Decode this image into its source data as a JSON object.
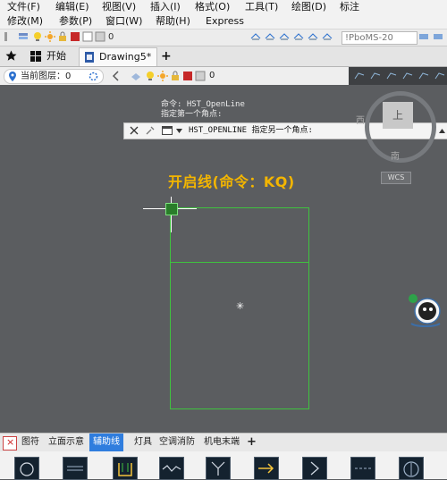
{
  "menu": {
    "row1": [
      "文件(F)",
      "编辑(E)",
      "视图(V)",
      "插入(I)",
      "格式(O)",
      "工具(T)",
      "绘图(D)",
      "标注"
    ],
    "row2": [
      "修改(M)",
      "参数(P)",
      "窗口(W)",
      "帮助(H)",
      "Express"
    ]
  },
  "toolbar": {
    "layer_value": "0",
    "right_field": "!PboMS-20"
  },
  "tabs": {
    "start_label": "开始",
    "drawing_label": "Drawing5*",
    "add_label": "+"
  },
  "layerbar": {
    "current_layer_label": "当前图层：0",
    "layer_value": "0"
  },
  "command": {
    "line1": "命令: HST_OpenLine",
    "line2": "指定第一个角点:",
    "bar_text": "HST_OPENLINE 指定另一个角点:"
  },
  "caption": "开启线(命令：KQ)",
  "navcube": {
    "face": "上",
    "west": "西",
    "south": "南",
    "wcs": "WCS"
  },
  "bottom_tabs": [
    "图符",
    "立面示意",
    "辅助线",
    "灯具",
    "空调消防",
    "机电末端"
  ],
  "bottom_active": "辅助线",
  "bottom_add": "+",
  "bottom_close": "×",
  "colors": {
    "canvas": "#5b5d60",
    "rectangle": "#3fc33f",
    "caption": "#f3b500",
    "active_tab": "#2f7dde"
  }
}
